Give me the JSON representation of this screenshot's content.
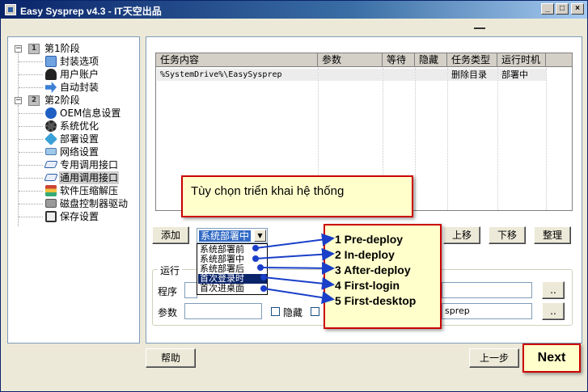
{
  "window": {
    "title": "Easy Sysprep v4.3 - IT天空出品",
    "minimize_label": "_",
    "maximize_label": "□",
    "close_label": "×"
  },
  "tree": {
    "items": [
      {
        "label": "第1阶段",
        "badge": "1",
        "expander": "−",
        "icon": "stage-1-icon"
      },
      {
        "label": "封装选项",
        "icon": "monitor-icon"
      },
      {
        "label": "用户账户",
        "icon": "user-icon"
      },
      {
        "label": "自动封装",
        "icon": "arrow-right-icon"
      },
      {
        "label": "第2阶段",
        "badge": "2",
        "expander": "−",
        "icon": "stage-2-icon"
      },
      {
        "label": "OEM信息设置",
        "icon": "info-icon"
      },
      {
        "label": "系统优化",
        "icon": "gear-icon"
      },
      {
        "label": "部署设置",
        "icon": "deploy-icon"
      },
      {
        "label": "网络设置",
        "icon": "network-icon"
      },
      {
        "label": "专用调用接口",
        "icon": "interface-icon"
      },
      {
        "label": "通用调用接口",
        "icon": "interface-icon",
        "selected": true
      },
      {
        "label": "软件压缩解压",
        "icon": "archive-icon"
      },
      {
        "label": "磁盘控制器驱动",
        "icon": "disk-icon"
      },
      {
        "label": "保存设置",
        "icon": "save-icon"
      }
    ]
  },
  "table": {
    "columns": [
      "任务内容",
      "参数",
      "等待",
      "隐藏",
      "任务类型",
      "运行时机"
    ],
    "rows": [
      {
        "content": "%SystemDrive%\\EasySysprep",
        "params": "",
        "wait": "",
        "hidden": "",
        "type": "删除目录",
        "timing": "部署中"
      }
    ]
  },
  "toolbar": {
    "add_label": "添加",
    "up_label": "上移",
    "down_label": "下移",
    "organize_label": "整理"
  },
  "dropdown": {
    "selected": "系统部署中",
    "options": [
      "系统部署前",
      "系统部署中",
      "系统部署后",
      "首次登录时",
      "首次进桌面"
    ],
    "highlighted_index": 3
  },
  "run_group": {
    "title": "运行",
    "program_label": "程序",
    "params_label": "参数",
    "hidden_label": "隐藏",
    "browse_label": "..",
    "second_field_value": "sprep",
    "browse2_label": ".."
  },
  "footer": {
    "help_label": "帮助",
    "prev_label": "上一步",
    "next_label": "Next"
  },
  "annotations": {
    "title": "Tùy chọn triển khai hệ thống",
    "stages": [
      "1 Pre-deploy",
      "2 In-deploy",
      "3 After-deploy",
      "4 First-login",
      "5 First-desktop"
    ]
  },
  "colors": {
    "title_bar": "#0a246a",
    "callout_bg": "#ffffcc",
    "callout_border": "#cc0000",
    "arrow": "#1a3fc8",
    "selection": "#316ac5"
  }
}
